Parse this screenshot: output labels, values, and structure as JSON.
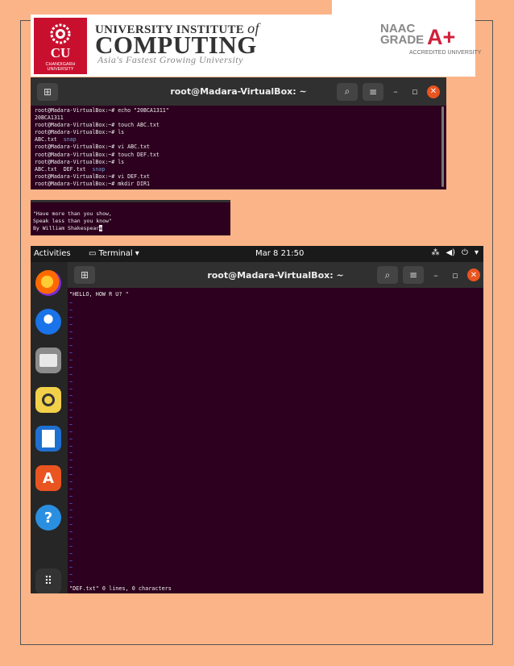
{
  "header": {
    "logo_letters": "CU",
    "logo_sub": "CHANDIGARH UNIVERSITY",
    "line1": "UNIVERSITY INSTITUTE",
    "line1_of": "of",
    "line2": "COMPUTING",
    "tagline": "Asia's Fastest Growing University",
    "naac": "NAAC",
    "grade": "GRADE",
    "aplus": "A+",
    "accredited": "ACCREDITED UNIVERSITY"
  },
  "terminal1": {
    "title": "root@Madara-VirtualBox: ~",
    "lines": [
      {
        "text": "root@Madara-VirtualBox:~# echo \"20BCA1311\""
      },
      {
        "text": "20BCA1311"
      },
      {
        "text": "root@Madara-VirtualBox:~# touch ABC.txt"
      },
      {
        "text": "root@Madara-VirtualBox:~# ls"
      },
      {
        "text": "ABC.txt  ",
        "snap": "snap"
      },
      {
        "text": "root@Madara-VirtualBox:~# vi ABC.txt"
      },
      {
        "text": "root@Madara-VirtualBox:~# touch DEF.txt"
      },
      {
        "text": "root@Madara-VirtualBox:~# ls"
      },
      {
        "text": "ABC.txt  DEF.txt  ",
        "snap": "snap"
      },
      {
        "text": "root@Madara-VirtualBox:~# vi DEF.txt"
      },
      {
        "text": "root@Madara-VirtualBox:~# mkdir DIR1"
      }
    ]
  },
  "terminal2": {
    "line1": "\"Have more than you show,",
    "line2": "Speak less than you know\"",
    "line3_prefix": "By William Shakespear",
    "line3_cursor": "e"
  },
  "desktop": {
    "activities": "Activities",
    "app_name": "Terminal",
    "clock": "Mar 8  21:50",
    "dock": [
      "firefox-icon",
      "thunderbird-icon",
      "files-icon",
      "rhythmbox-icon",
      "writer-icon",
      "software-icon",
      "help-icon",
      "apps-grid-icon"
    ]
  },
  "terminal3": {
    "title": "root@Madara-VirtualBox: ~",
    "first_line": "\"HELLO, HOW R U? \"",
    "tilde_count": 40,
    "status": "\"DEF.txt\" 0 lines, 0 characters"
  }
}
